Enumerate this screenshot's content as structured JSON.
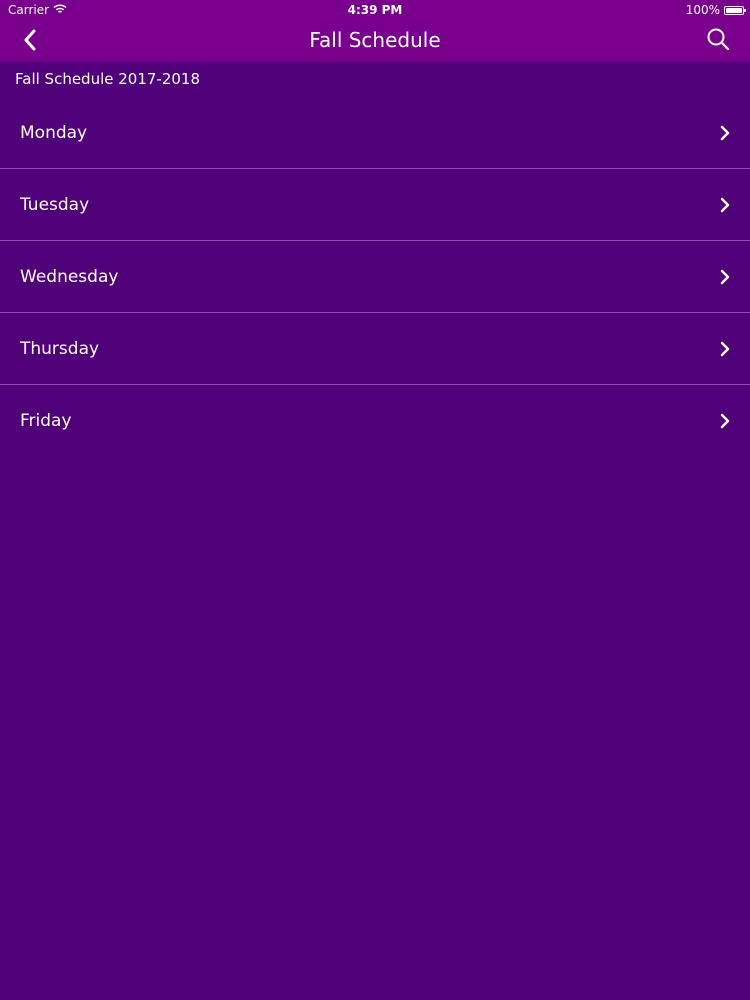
{
  "status_bar": {
    "carrier": "Carrier",
    "time": "4:39 PM",
    "battery": "100%"
  },
  "nav": {
    "title": "Fall Schedule",
    "back_icon": "chevron-left-icon",
    "search_icon": "search-icon"
  },
  "section": {
    "header": "Fall Schedule 2017-2018"
  },
  "days": [
    {
      "label": "Monday"
    },
    {
      "label": "Tuesday"
    },
    {
      "label": "Wednesday"
    },
    {
      "label": "Thursday"
    },
    {
      "label": "Friday"
    }
  ],
  "colors": {
    "nav_background": "#78008c",
    "page_background": "#500078",
    "text": "#ffffff",
    "separator": "#be96dc"
  }
}
